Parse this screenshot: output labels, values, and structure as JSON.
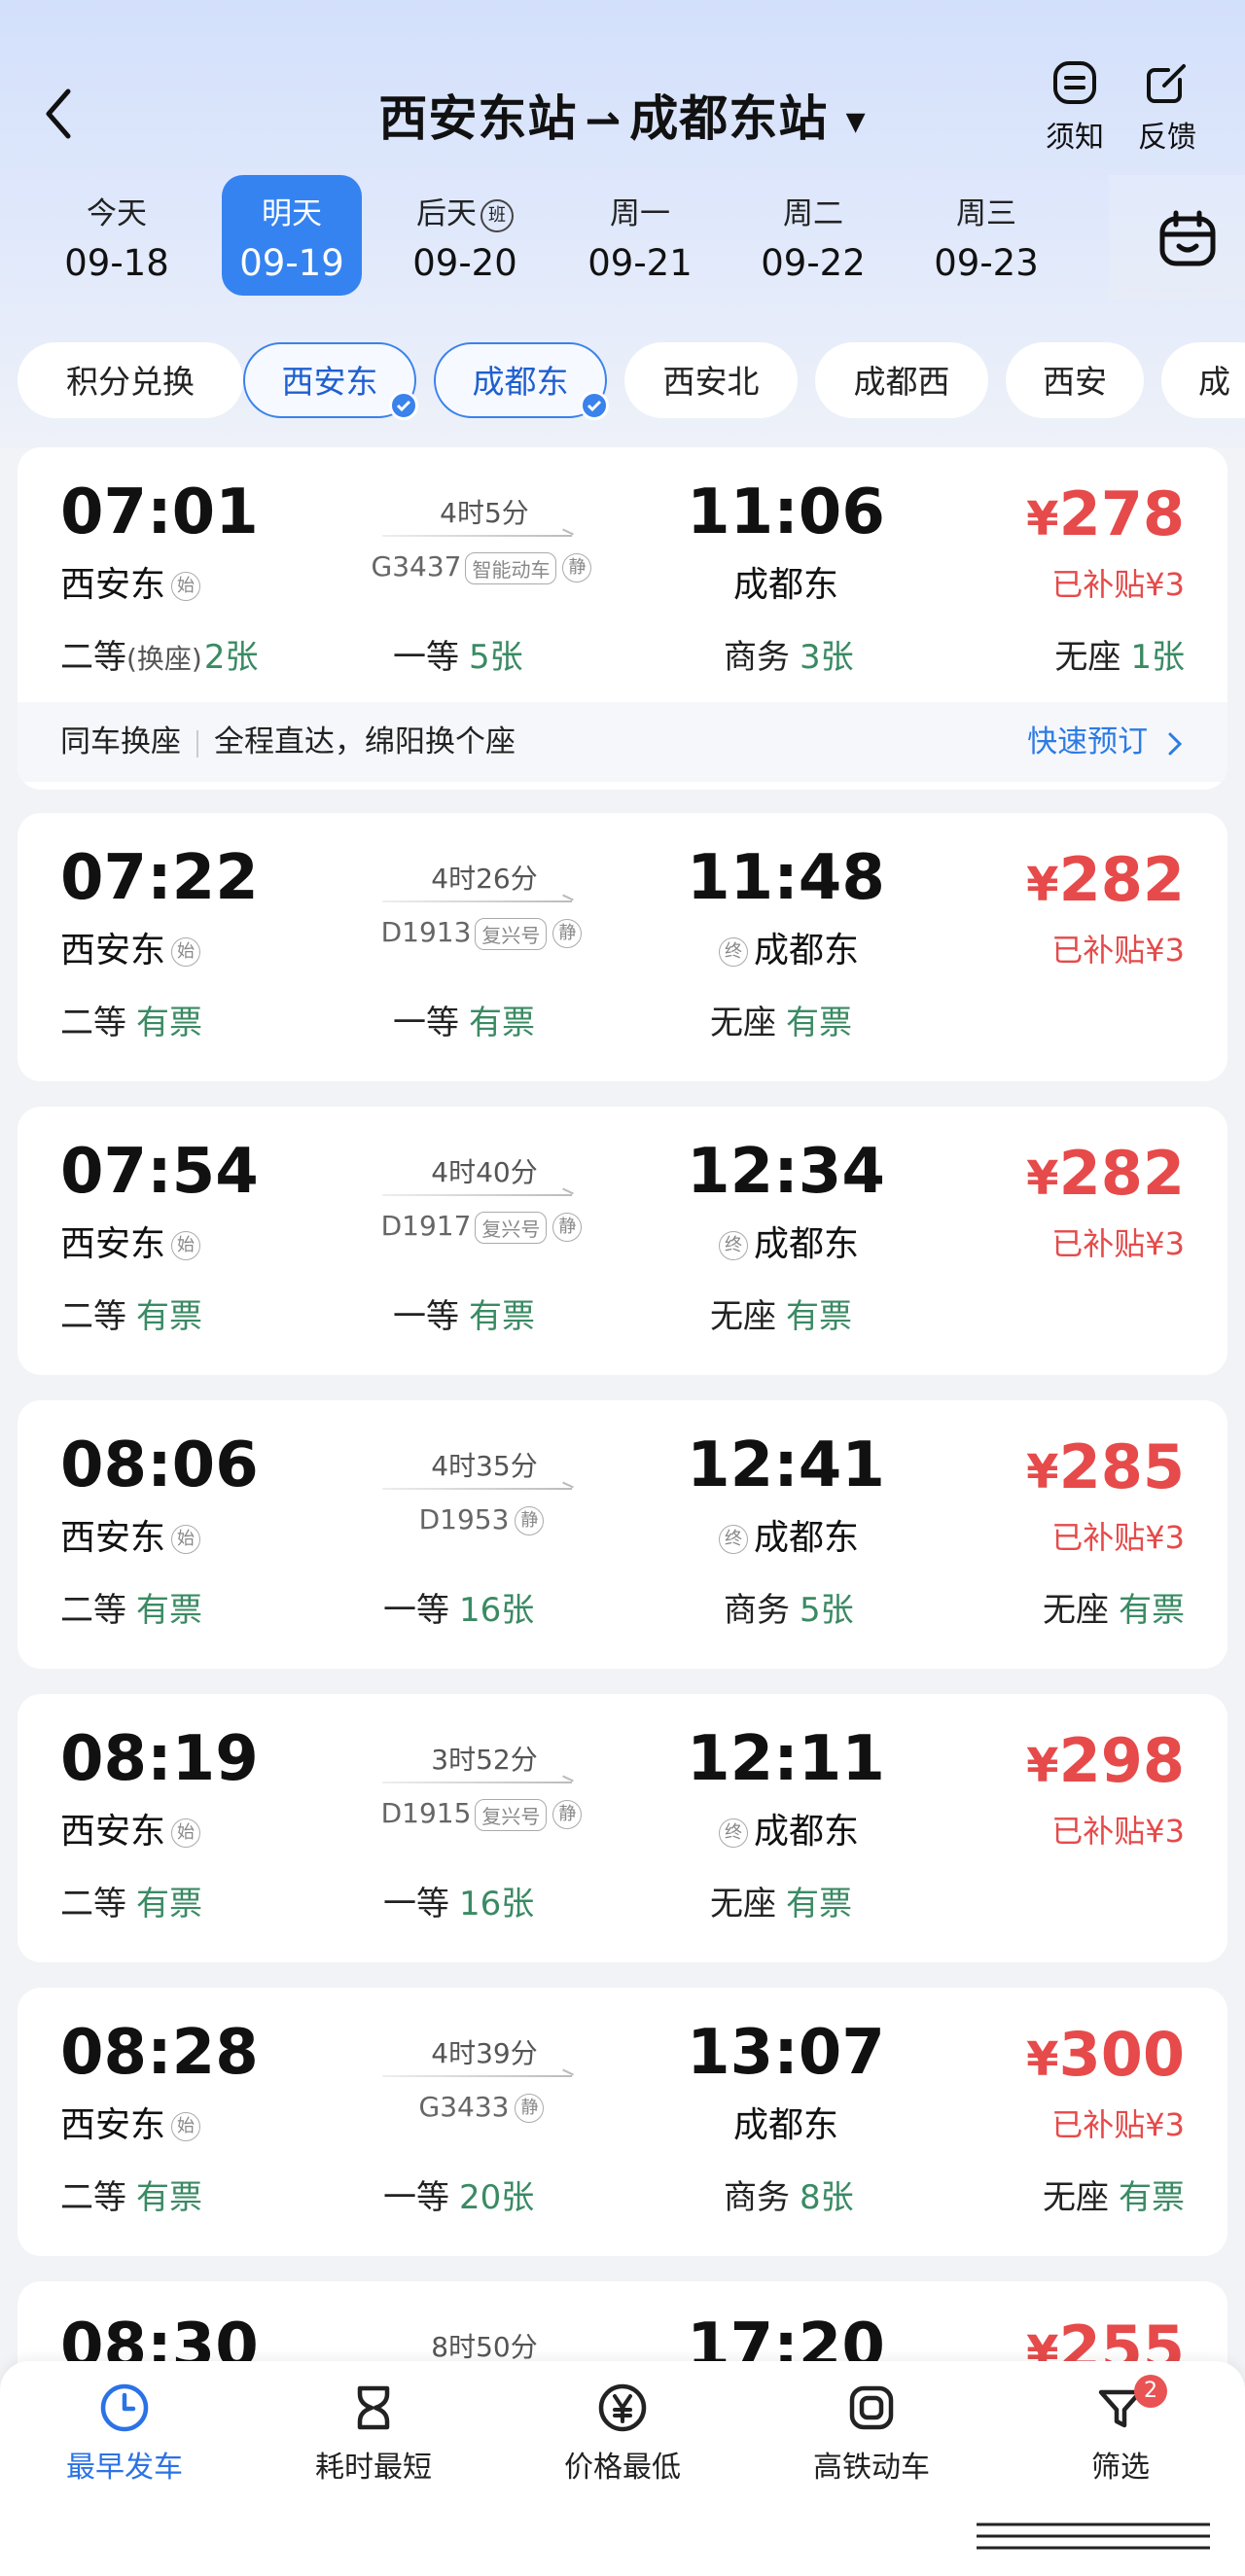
{
  "header": {
    "title_from": "西安东站",
    "title_arrow": "⇀",
    "title_to": "成都东站",
    "notice_label": "须知",
    "feedback_label": "反馈"
  },
  "dates": [
    {
      "day": "今天",
      "date": "09-18",
      "active": false
    },
    {
      "day": "明天",
      "date": "09-19",
      "active": true
    },
    {
      "day": "后天",
      "date": "09-20",
      "active": false,
      "badge": "班"
    },
    {
      "day": "周一",
      "date": "09-21",
      "active": false
    },
    {
      "day": "周二",
      "date": "09-22",
      "active": false
    },
    {
      "day": "周三",
      "date": "09-23",
      "active": false
    }
  ],
  "chips": [
    "积分兑换",
    "西安东",
    "成都东",
    "西安北",
    "成都西",
    "西安",
    "成"
  ],
  "trains": [
    {
      "dep_time": "07:01",
      "dep_station": "西安东",
      "dep_tag": "始",
      "arr_time": "11:06",
      "arr_station": "成都东",
      "duration": "4时5分",
      "train_no": "G3437",
      "train_tags": [
        "智能动车",
        "静"
      ],
      "price": "278",
      "yen": "¥",
      "subsidy": "已补贴¥3",
      "seats": [
        {
          "name": "二等",
          "note": "(换座)",
          "count": "2张"
        },
        {
          "name": "一等",
          "count": "5张"
        },
        {
          "name": "商务",
          "count": "3张"
        },
        {
          "name": "无座",
          "count": "1张"
        }
      ],
      "transfer": {
        "label": "同车换座",
        "desc": "全程直达，绵阳换个座",
        "link": "快速预订"
      }
    },
    {
      "dep_time": "07:22",
      "dep_station": "西安东",
      "dep_tag": "始",
      "arr_time": "11:48",
      "arr_station": "成都东",
      "arr_tag": "终",
      "duration": "4时26分",
      "train_no": "D1913",
      "train_tags": [
        "复兴号",
        "静"
      ],
      "price": "282",
      "yen": "¥",
      "subsidy": "已补贴¥3",
      "seats": [
        {
          "name": "二等",
          "count": "有票"
        },
        {
          "name": "一等",
          "count": "有票"
        },
        {
          "name": "无座",
          "count": "有票"
        }
      ]
    },
    {
      "dep_time": "07:54",
      "dep_station": "西安东",
      "dep_tag": "始",
      "arr_time": "12:34",
      "arr_station": "成都东",
      "arr_tag": "终",
      "duration": "4时40分",
      "train_no": "D1917",
      "train_tags": [
        "复兴号",
        "静"
      ],
      "price": "282",
      "yen": "¥",
      "subsidy": "已补贴¥3",
      "seats": [
        {
          "name": "二等",
          "count": "有票"
        },
        {
          "name": "一等",
          "count": "有票"
        },
        {
          "name": "无座",
          "count": "有票"
        }
      ]
    },
    {
      "dep_time": "08:06",
      "dep_station": "西安东",
      "dep_tag": "始",
      "arr_time": "12:41",
      "arr_station": "成都东",
      "arr_tag": "终",
      "duration": "4时35分",
      "train_no": "D1953",
      "train_tags": [
        "静"
      ],
      "price": "285",
      "yen": "¥",
      "subsidy": "已补贴¥3",
      "seats": [
        {
          "name": "二等",
          "count": "有票"
        },
        {
          "name": "一等",
          "count": "16张"
        },
        {
          "name": "商务",
          "count": "5张"
        },
        {
          "name": "无座",
          "count": "有票"
        }
      ]
    },
    {
      "dep_time": "08:19",
      "dep_station": "西安东",
      "dep_tag": "始",
      "arr_time": "12:11",
      "arr_station": "成都东",
      "arr_tag": "终",
      "duration": "3时52分",
      "train_no": "D1915",
      "train_tags": [
        "复兴号",
        "静"
      ],
      "price": "298",
      "yen": "¥",
      "subsidy": "已补贴¥3",
      "seats": [
        {
          "name": "二等",
          "count": "有票"
        },
        {
          "name": "一等",
          "count": "16张"
        },
        {
          "name": "无座",
          "count": "有票"
        }
      ]
    },
    {
      "dep_time": "08:28",
      "dep_station": "西安东",
      "dep_tag": "始",
      "arr_time": "13:07",
      "arr_station": "成都东",
      "duration": "4时39分",
      "train_no": "G3433",
      "train_tags": [
        "静"
      ],
      "price": "300",
      "yen": "¥",
      "subsidy": "已补贴¥3",
      "seats": [
        {
          "name": "二等",
          "count": "有票"
        },
        {
          "name": "一等",
          "count": "20张"
        },
        {
          "name": "商务",
          "count": "8张"
        },
        {
          "name": "无座",
          "count": "有票"
        }
      ]
    },
    {
      "dep_time": "08:30",
      "arr_time": "17:20",
      "duration": "8时50分",
      "price": "255",
      "yen": "¥"
    }
  ],
  "bottom_nav": [
    {
      "label": "最早发车",
      "icon": "clock-icon",
      "active": true
    },
    {
      "label": "耗时最短",
      "icon": "hourglass-icon",
      "active": false
    },
    {
      "label": "价格最低",
      "icon": "yen-icon",
      "active": false
    },
    {
      "label": "高铁动车",
      "icon": "train-icon",
      "active": false
    },
    {
      "label": "筛选",
      "icon": "filter-icon",
      "active": false,
      "badge": "2"
    }
  ],
  "colors": {
    "accent": "#3583f0",
    "price": "#e64a4a",
    "available": "#3a8a63",
    "link": "#2c7be5"
  }
}
